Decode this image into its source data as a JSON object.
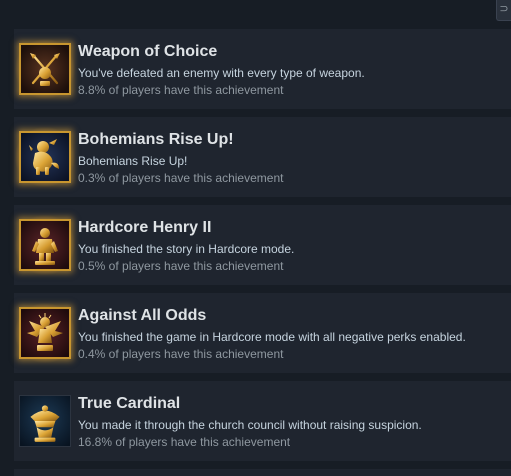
{
  "top_control": {
    "glyph": "⊃"
  },
  "achievements": [
    {
      "title": "Weapon of Choice",
      "description": "You've defeated an enemy with every type of weapon.",
      "percent_text": "8.8% of players have this achievement",
      "percent": 8.8,
      "icon": "crossed-weapons-icon",
      "icon_bg": "#3a1f16"
    },
    {
      "title": "Bohemians Rise Up!",
      "description": "Bohemians Rise Up!",
      "percent_text": "0.3% of players have this achievement",
      "percent": 0.3,
      "icon": "lion-icon",
      "icon_bg": "#14203a"
    },
    {
      "title": "Hardcore Henry II",
      "description": "You finished the story in Hardcore mode.",
      "percent_text": "0.5% of players have this achievement",
      "percent": 0.5,
      "icon": "knight-statue-icon",
      "icon_bg": "#3a1a1c"
    },
    {
      "title": "Against All Odds",
      "description": "You finished the game in Hardcore mode with all negative perks enabled.",
      "percent_text": "0.4% of players have this achievement",
      "percent": 0.4,
      "icon": "winged-figure-icon",
      "icon_bg": "#3a1a1c"
    },
    {
      "title": "True Cardinal",
      "description": "You made it through the church council without raising suspicion.",
      "percent_text": "16.8% of players have this achievement",
      "percent": 16.8,
      "icon": "cardinal-hat-icon",
      "icon_bg": "#0d1c2c"
    }
  ],
  "colors": {
    "page_bg": "#171d25",
    "row_bg": "#1f252f",
    "title": "#dfe3e6",
    "description": "#c6d4df",
    "percent": "#8f98a0",
    "gold": "#c8962f"
  }
}
